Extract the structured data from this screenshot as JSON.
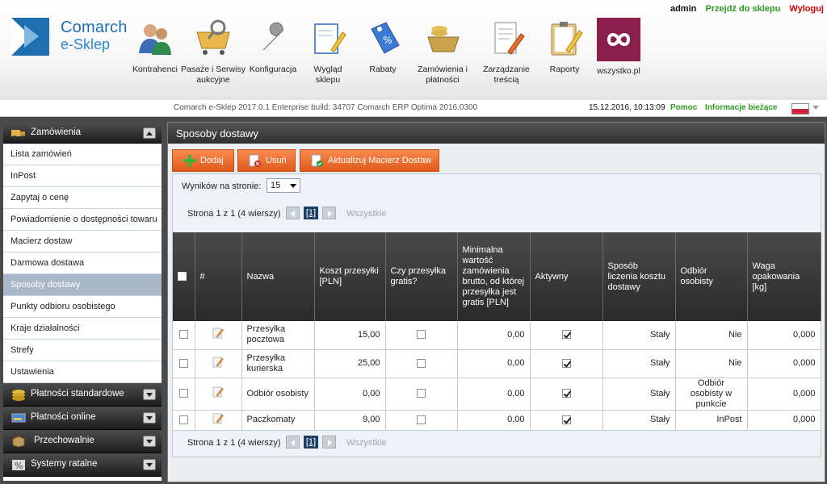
{
  "header": {
    "logo_line1": "Comarch",
    "logo_line2": "e-Sklep",
    "user": "admin",
    "goto_shop": "Przejdź do sklepu",
    "logout": "Wyloguj",
    "nav": [
      {
        "label": "Kontrahenci",
        "icon": "contractors-icon"
      },
      {
        "label": "Pasaże i Serwisy aukcyjne",
        "icon": "auction-cart-icon"
      },
      {
        "label": "Konfiguracja",
        "icon": "wrench-icon"
      },
      {
        "label": "Wygląd sklepu",
        "icon": "design-pencil-icon"
      },
      {
        "label": "Rabaty",
        "icon": "discount-tag-icon"
      },
      {
        "label": "Zamówienia i płatności",
        "icon": "orders-basket-icon"
      },
      {
        "label": "Zarządzanie treścią",
        "icon": "content-pencil-icon"
      },
      {
        "label": "Raporty",
        "icon": "clipboard-icon"
      },
      {
        "label": "wszystko.pl",
        "icon": "wszystko-infinity-icon"
      }
    ]
  },
  "statusbar": {
    "build": "Comarch e-Sklep 2017.0.1 Enterprise build: 34707 Comarch ERP Optima 2016.0300",
    "datetime": "15.12.2016, 10:13:09",
    "help": "Pomoc",
    "news": "Informacje bieżące"
  },
  "sidebar": {
    "section_orders": "Zamówienia",
    "items": [
      "Lista zamówień",
      "InPost",
      "Zapytaj o cenę",
      "Powiadomienie o dostępności towaru",
      "Macierz dostaw",
      "Darmowa dostawa",
      "Sposoby dostawy",
      "Punkty odbioru osobistego",
      "Kraje działalności",
      "Strefy",
      "Ustawienia"
    ],
    "active_index": 6,
    "collapsed": [
      "Płatności standardowe",
      "Płatności online",
      "Przechowalnie",
      "Systemy ratalne"
    ]
  },
  "main": {
    "title": "Sposoby dostawy",
    "buttons": {
      "add": "Dodaj",
      "delete": "Usuń",
      "update": "Aktualizuj Macierz Dostaw"
    },
    "per_page_label": "Wyników na stronie:",
    "per_page_value": "15",
    "pager": {
      "text": "Strona 1 z 1 (4 wierszy)",
      "current": "[1]",
      "all": "Wszystkie"
    },
    "columns": {
      "num": "#",
      "name": "Nazwa",
      "cost": "Koszt przesyłki [PLN]",
      "free": "Czy przesyłka gratis?",
      "min": "Minimalna wartość zamówienia brutto, od której przesyłka jest gratis [PLN]",
      "active": "Aktywny",
      "method": "Sposób liczenia kosztu dostawy",
      "pickup": "Odbiór osobisty",
      "weight": "Waga opakowania [kg]"
    },
    "rows": [
      {
        "name": "Przesyłka pocztowa",
        "cost": "15,00",
        "free": false,
        "min": "0,00",
        "active": true,
        "method": "Stały",
        "pickup": "Nie",
        "weight": "0,000"
      },
      {
        "name": "Przesyłka kurierska",
        "cost": "25,00",
        "free": false,
        "min": "0,00",
        "active": true,
        "method": "Stały",
        "pickup": "Nie",
        "weight": "0,000"
      },
      {
        "name": "Odbiór osobisty",
        "cost": "0,00",
        "free": false,
        "min": "0,00",
        "active": true,
        "method": "Stały",
        "pickup": "Odbiór osobisty w punkcie",
        "weight": "0,000"
      },
      {
        "name": "Paczkomaty",
        "cost": "9,00",
        "free": false,
        "min": "0,00",
        "active": true,
        "method": "Stały",
        "pickup": "InPost",
        "weight": "0,000"
      }
    ]
  },
  "colors": {
    "accent_orange": "#e8662b",
    "link_green": "#2d9a22",
    "logout_red": "#d40000",
    "brand_blue": "#1d6fb0",
    "active_item": "#a9b8c8"
  }
}
